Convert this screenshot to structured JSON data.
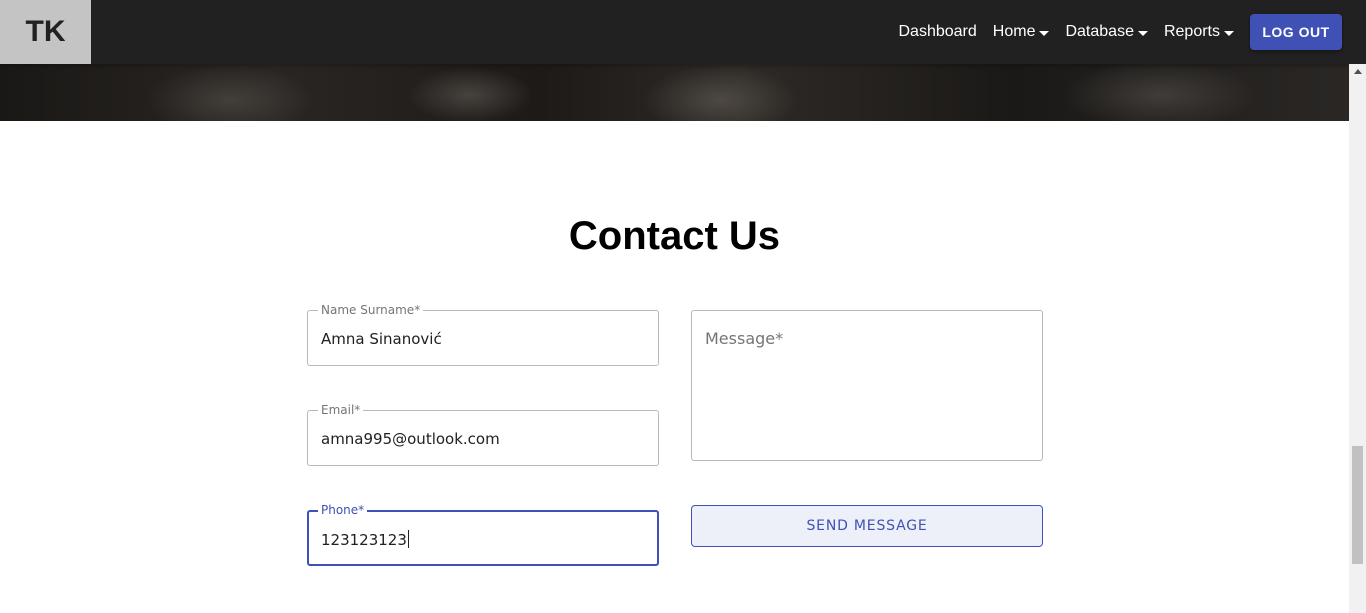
{
  "navbar": {
    "logo": "TK",
    "items": [
      {
        "label": "Dashboard",
        "dropdown": false
      },
      {
        "label": "Home",
        "dropdown": true
      },
      {
        "label": "Database",
        "dropdown": true
      },
      {
        "label": "Reports",
        "dropdown": true
      }
    ],
    "logout_label": "LOG OUT"
  },
  "contact": {
    "title": "Contact Us",
    "name_label": "Name Surname*",
    "name_value": "Amna Sinanović",
    "email_label": "Email*",
    "email_value": "amna995@outlook.com",
    "phone_label": "Phone*",
    "phone_value": "123123123",
    "message_placeholder": "Message*",
    "send_label": "SEND MESSAGE"
  },
  "colors": {
    "navbar_bg": "#212121",
    "accent": "#3f51b5",
    "logo_bg": "#c4c4c4"
  },
  "icons": [
    "chevron-down-icon",
    "scroll-up-arrow-icon"
  ]
}
